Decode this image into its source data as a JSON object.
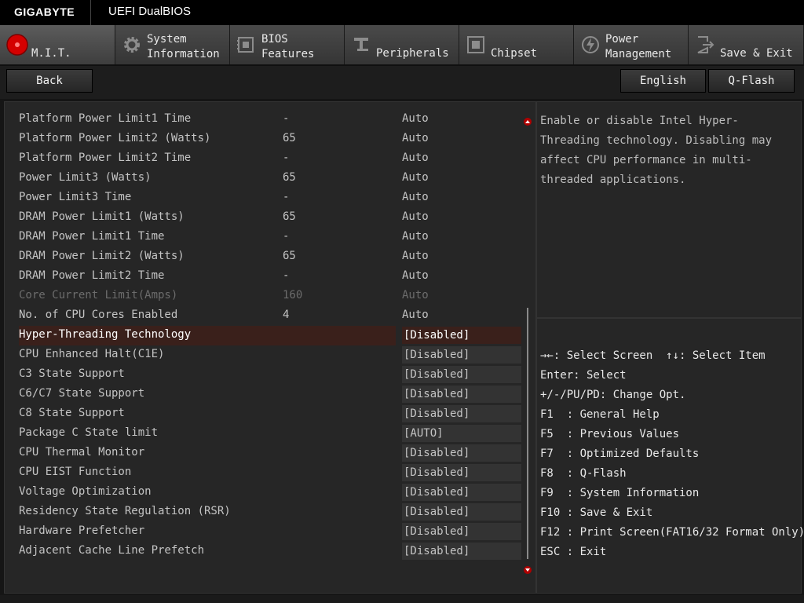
{
  "header": {
    "brand": "GIGABYTE",
    "title": "UEFI DualBIOS"
  },
  "tabs": [
    {
      "label": "M.I.T.",
      "icon": "mit-red-dot-icon",
      "active": true
    },
    {
      "label": "System\nInformation",
      "icon": "gear-icon"
    },
    {
      "label": "BIOS\nFeatures",
      "icon": "bios-chip-icon"
    },
    {
      "label": "Peripherals",
      "icon": "peripherals-icon"
    },
    {
      "label": "Chipset",
      "icon": "chipset-icon"
    },
    {
      "label": "Power\nManagement",
      "icon": "power-icon"
    },
    {
      "label": "Save & Exit",
      "icon": "exit-icon"
    }
  ],
  "toolbar": {
    "back": "Back",
    "language": "English",
    "qflash": "Q-Flash"
  },
  "settings": {
    "rows": [
      {
        "name": "Platform Power Limit1 Time",
        "v1": "-",
        "v2": "Auto"
      },
      {
        "name": "Platform Power Limit2 (Watts)",
        "v1": "65",
        "v2": "Auto"
      },
      {
        "name": "Platform Power Limit2 Time",
        "v1": "-",
        "v2": "Auto"
      },
      {
        "name": "Power Limit3 (Watts)",
        "v1": "65",
        "v2": "Auto"
      },
      {
        "name": "Power Limit3 Time",
        "v1": "-",
        "v2": "Auto"
      },
      {
        "name": "DRAM Power Limit1 (Watts)",
        "v1": "65",
        "v2": "Auto"
      },
      {
        "name": "DRAM Power Limit1 Time",
        "v1": "-",
        "v2": "Auto"
      },
      {
        "name": "DRAM Power Limit2 (Watts)",
        "v1": "65",
        "v2": "Auto"
      },
      {
        "name": "DRAM Power Limit2 Time",
        "v1": "-",
        "v2": "Auto"
      },
      {
        "name": "Core Current Limit(Amps)",
        "v1": "160",
        "v2": "Auto"
      },
      {
        "name": "No. of CPU Cores Enabled",
        "v1": "4",
        "v2": "Auto"
      },
      {
        "name": "Hyper-Threading Technology",
        "v": "[Disabled]"
      },
      {
        "name": "CPU Enhanced Halt(C1E)",
        "v": "[Disabled]"
      },
      {
        "name": "C3 State Support",
        "v": "[Disabled]"
      },
      {
        "name": "C6/C7 State Support",
        "v": "[Disabled]"
      },
      {
        "name": "C8 State Support",
        "v": "[Disabled]"
      },
      {
        "name": "Package C State limit",
        "v": "[AUTO]"
      },
      {
        "name": "CPU Thermal Monitor",
        "v": "[Disabled]"
      },
      {
        "name": "CPU EIST Function",
        "v": "[Disabled]"
      },
      {
        "name": "Voltage Optimization",
        "v": "[Disabled]"
      },
      {
        "name": "Residency State Regulation (RSR)",
        "v": "[Disabled]"
      },
      {
        "name": "Hardware Prefetcher",
        "v": "[Disabled]"
      },
      {
        "name": "Adjacent Cache Line Prefetch",
        "v": "[Disabled]"
      }
    ]
  },
  "help": {
    "text": "Enable or disable Intel Hyper-Threading technology. Disabling may affect CPU performance in multi-threaded applications."
  },
  "keys": [
    "→←: Select Screen  ↑↓: Select Item",
    "Enter: Select",
    "+/-/PU/PD: Change Opt.",
    "F1  : General Help",
    "F5  : Previous Values",
    "F7  : Optimized Defaults",
    "F8  : Q-Flash",
    "F9  : System Information",
    "F10 : Save & Exit",
    "F12 : Print Screen(FAT16/32 Format Only)",
    "ESC : Exit"
  ],
  "colors": {
    "selection": "#3a201b",
    "accent_red": "#e00000",
    "panel": "#262626"
  }
}
